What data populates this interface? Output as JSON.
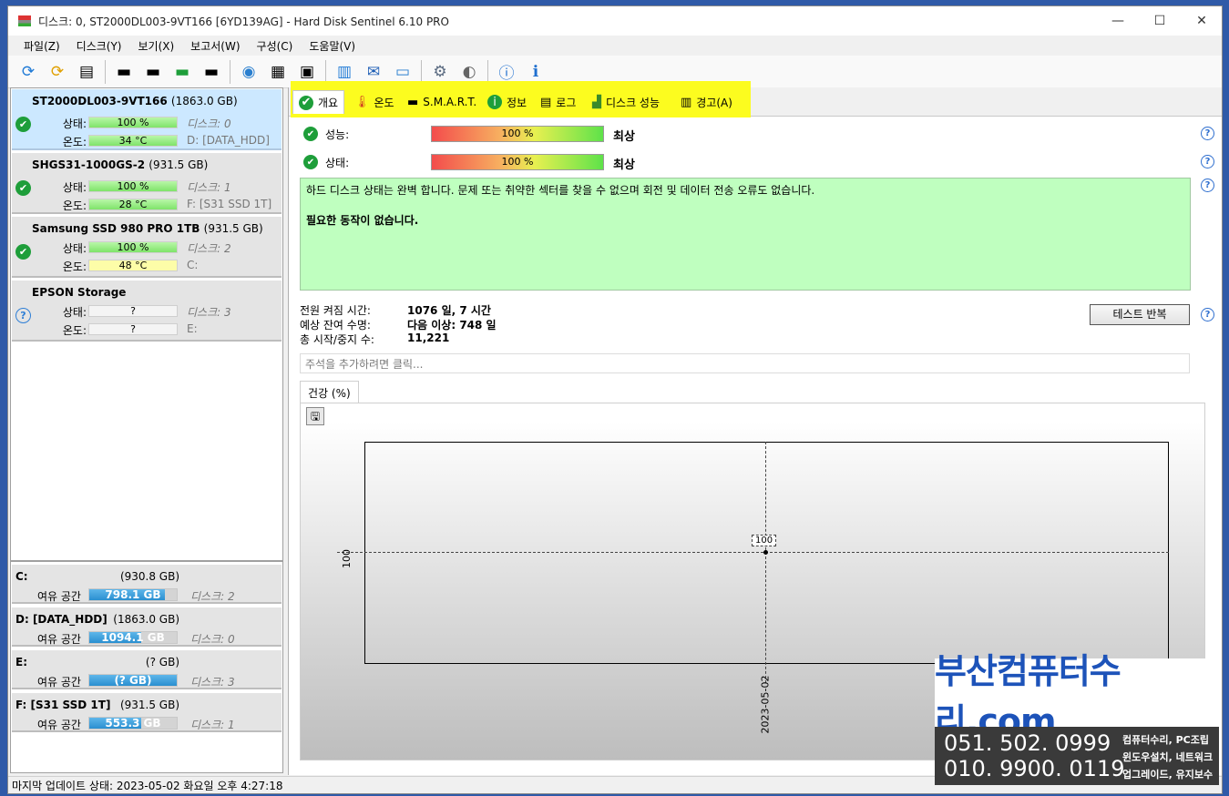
{
  "window": {
    "title": "디스크: 0, ST2000DL003-9VT166 [6YD139AG]  -  Hard Disk Sentinel 6.10 PRO",
    "minimize": "—",
    "maximize": "☐",
    "close": "✕"
  },
  "menu": [
    "파일(Z)",
    "디스크(Y)",
    "보기(X)",
    "보고서(W)",
    "구성(C)",
    "도움말(V)"
  ],
  "toolbar_icons": [
    "refresh-icon",
    "refresh-warning-icon",
    "disk-list-icon",
    "disk-test-icon",
    "disk-schedule-icon",
    "disk-ok-icon",
    "disk-search-icon",
    "internet-icon",
    "tools-icon",
    "printer-icon",
    "report-icon",
    "email-icon",
    "network-icon",
    "settings-icon",
    "sound-icon",
    "help-icon",
    "info-icon"
  ],
  "disks": [
    {
      "name": "ST2000DL003-9VT166",
      "size": "(1863.0 GB)",
      "status_label": "상태:",
      "status": "100 %",
      "temp_label": "온도:",
      "temp": "34 °C",
      "disk_no": "디스크: 0",
      "volume": "D: [DATA_HDD]"
    },
    {
      "name": "SHGS31-1000GS-2",
      "size": "(931.5 GB)",
      "status_label": "상태:",
      "status": "100 %",
      "temp_label": "온도:",
      "temp": "28 °C",
      "disk_no": "디스크: 1",
      "volume": "F: [S31 SSD 1T]"
    },
    {
      "name": "Samsung SSD 980 PRO 1TB",
      "size": "(931.5 GB)",
      "status_label": "상태:",
      "status": "100 %",
      "temp_label": "온도:",
      "temp": "48 °C",
      "disk_no": "디스크: 2",
      "volume": "C:"
    },
    {
      "name": "EPSON  Storage",
      "size": "",
      "status_label": "상태:",
      "status": "?",
      "temp_label": "온도:",
      "temp": "?",
      "disk_no": "디스크: 3",
      "volume": "E:"
    }
  ],
  "volumes": [
    {
      "name": "C:",
      "size": "(930.8 GB)",
      "free_label": "여유 공간",
      "free": "798.1 GB",
      "disk": "디스크: 2",
      "fill": 0.86
    },
    {
      "name": "D: [DATA_HDD]",
      "size": "(1863.0 GB)",
      "free_label": "여유 공간",
      "free": "1094.1 GB",
      "disk": "디스크: 0",
      "fill": 0.59
    },
    {
      "name": "E:",
      "size": "(? GB)",
      "free_label": "여유 공간",
      "free": "(? GB)",
      "disk": "디스크: 3",
      "fill": 1.0
    },
    {
      "name": "F: [S31 SSD 1T]",
      "size": "(931.5 GB)",
      "free_label": "여유 공간",
      "free": "553.3 GB",
      "disk": "디스크: 1",
      "fill": 0.59
    }
  ],
  "status_bar": "마지막 업데이트 상태: 2023-05-02 화요일 오후 4:27:18",
  "tabs": [
    "개요",
    "온도",
    "S.M.A.R.T.",
    "정보",
    "로그",
    "디스크 성능",
    "경고(A)"
  ],
  "overview": {
    "performance_label": "성능:",
    "performance": "100 %",
    "performance_rating": "최상",
    "health_label": "상태:",
    "health": "100 %",
    "health_rating": "최상",
    "message": "하드 디스크 상태는 완벽 합니다. 문제 또는 취약한 섹터를 찾을 수 없으며 회전 및 데이터 전송 오류도 없습니다.",
    "action": "필요한 동작이 없습니다.",
    "power_on_label": "전원 켜짐 시간:",
    "power_on": "1076 일, 7 시간",
    "lifetime_label": "예상 잔여 수명:",
    "lifetime": "다음 이상: 748 일",
    "starts_label": "총 시작/중지 수:",
    "starts": "11,221",
    "test_button": "테스트 반복",
    "notes_placeholder": "주석을 추가하려면 클릭..."
  },
  "chart_data": {
    "type": "line",
    "title": "건강 (%)",
    "x": [
      "2023-05-02"
    ],
    "series": [
      {
        "values": [
          100
        ]
      }
    ],
    "ytick": "100",
    "data_label": "100"
  },
  "ad": {
    "title": "부산컴퓨터수리.com",
    "phone1": "051. 502. 0999",
    "phone2": "010. 9900. 0119",
    "s1": "컴퓨터수리, PC조립",
    "s2": "윈도우설치, 네트워크",
    "s3": "업그레이드, 유지보수"
  }
}
